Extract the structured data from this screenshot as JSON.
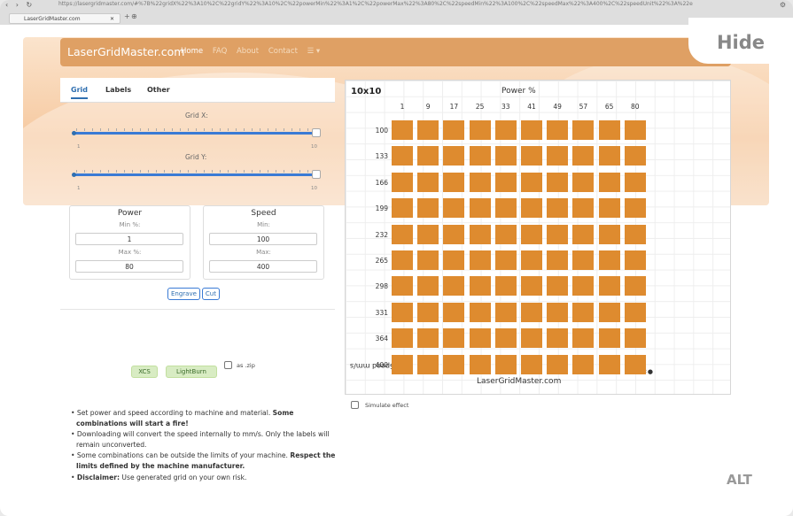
{
  "browser": {
    "url": "https://lasergridmaster.com/#%7B%22gridX%22%3A10%2C%22gridY%22%3A10%2C%22powerMin%22%3A1%2C%22powerMax%22%3A80%2C%22speedMin%22%3A100%2C%22speedMax%22%3A400%2C%22speedUnit%22%3A%22e",
    "tab_title": "LaserGridMaster.com",
    "tab_close": "✕",
    "new_tab": "+",
    "nav_glyphs": "‹ › ↻"
  },
  "navbar": {
    "brand": "LaserGridMaster.com",
    "links": [
      "Home",
      "FAQ",
      "About",
      "Contact"
    ],
    "menu_icon": "☰ ▾"
  },
  "overlay": {
    "hide": "Hide",
    "alt": "ALT"
  },
  "tabs": [
    "Grid",
    "Labels",
    "Other"
  ],
  "sliders": {
    "grid_x_label": "Grid X:",
    "grid_y_label": "Grid Y:",
    "min_tick": "1",
    "max_tick": "10",
    "grid_x_value": 10,
    "grid_y_value": 10
  },
  "power": {
    "title": "Power",
    "min_label": "Min %:",
    "min_value": "1",
    "max_label": "Max %:",
    "max_value": "80"
  },
  "speed": {
    "title": "Speed",
    "min_label": "Min:",
    "min_value": "100",
    "max_label": "Max:",
    "max_value": "400"
  },
  "modes": [
    "Engrave",
    "Cut"
  ],
  "export": {
    "xcs": "XCS",
    "lightburn": "LightBurn",
    "zip_label": "as .zip"
  },
  "notes": [
    {
      "text": "Set power and speed according to machine and material. ",
      "bold": "Some combinations will start a fire!"
    },
    {
      "text": "Downloading will convert the speed internally to mm/s. Only the labels will remain unconverted.",
      "bold": ""
    },
    {
      "text": "Some combinations can be outside the limits of your machine. ",
      "bold": "Respect the limits defined by the machine manufacturer."
    },
    {
      "bold_prefix": "Disclaimer:",
      "text": " Use generated grid on your own risk."
    }
  ],
  "grid": {
    "title": "10x10",
    "power_axis": "Power %",
    "power_values": [
      "1",
      "9",
      "17",
      "25",
      "33",
      "41",
      "49",
      "57",
      "65",
      "80"
    ],
    "speed_values": [
      "100",
      "133",
      "166",
      "199",
      "232",
      "265",
      "298",
      "331",
      "364",
      "400"
    ],
    "speed_axis": "Speed mm/s",
    "watermark": "LaserGridMaster.com",
    "cell_color": "#de8b2f"
  },
  "simulate_label": "Simulate effect"
}
